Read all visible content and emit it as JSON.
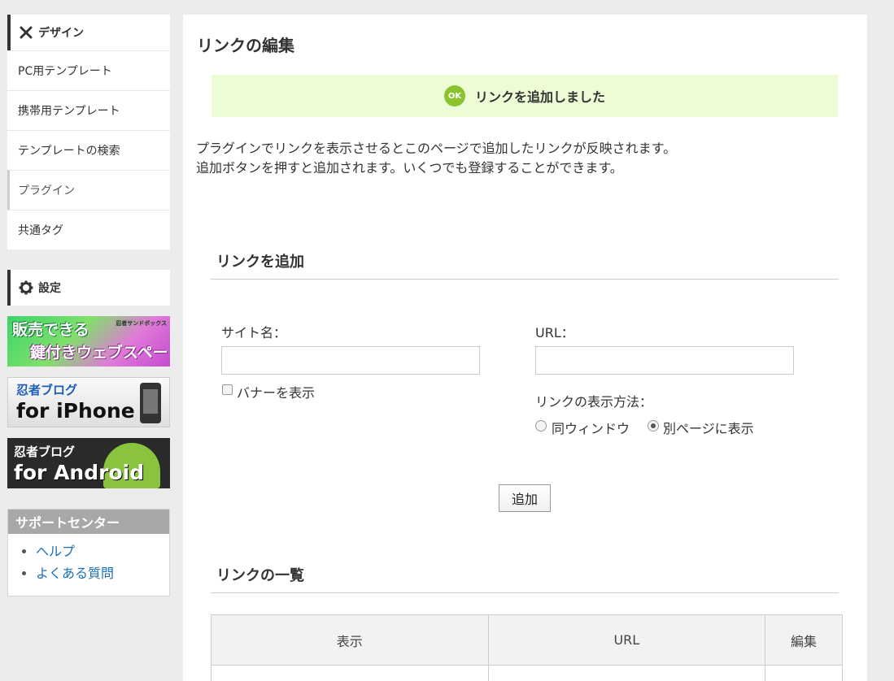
{
  "sidebar": {
    "design": {
      "title": "デザイン",
      "icon": "tools-icon",
      "items": [
        {
          "label": "PC用テンプレート"
        },
        {
          "label": "携帯用テンプレート"
        },
        {
          "label": "テンプレートの検索"
        },
        {
          "label": "プラグイン"
        },
        {
          "label": "共通タグ"
        }
      ]
    },
    "settings": {
      "title": "設定",
      "icon": "gear-icon"
    },
    "banners": {
      "sandbox": {
        "line1": "販売できる",
        "line2": "鍵付きウェブスペース",
        "brand": "忍者サンドボックス"
      },
      "iphone": {
        "line1": "忍者ブログ",
        "line2": "for iPhone"
      },
      "android": {
        "line1": "忍者ブログ",
        "line2": "for Android"
      }
    },
    "support": {
      "title": "サポートセンター",
      "links": [
        {
          "label": "ヘルプ"
        },
        {
          "label": "よくある質問"
        }
      ]
    }
  },
  "main": {
    "title": "リンクの編集",
    "notice": {
      "icon_text": "OK",
      "text": "リンクを追加しました"
    },
    "description": [
      "プラグインでリンクを表示させるとこのページで追加したリンクが反映されます。",
      "追加ボタンを押すと追加されます。いくつでも登録することができます。"
    ],
    "add_section": {
      "title": "リンクを追加",
      "site_name_label": "サイト名：",
      "site_name_value": "",
      "url_label": "URL：",
      "url_value": "",
      "banner_checkbox_label": "バナーを表示",
      "banner_checked": false,
      "display_method_label": "リンクの表示方法：",
      "options": [
        {
          "label": "同ウィンドウ",
          "selected": false
        },
        {
          "label": "別ページに表示",
          "selected": true
        }
      ],
      "add_button": "追加"
    },
    "list_section": {
      "title": "リンクの一覧",
      "columns": [
        "表示",
        "URL",
        "編集"
      ]
    }
  },
  "colors": {
    "accent_green": "#8bc32f",
    "notice_bg": "#ecfdd6",
    "link": "#1a6fb5"
  }
}
